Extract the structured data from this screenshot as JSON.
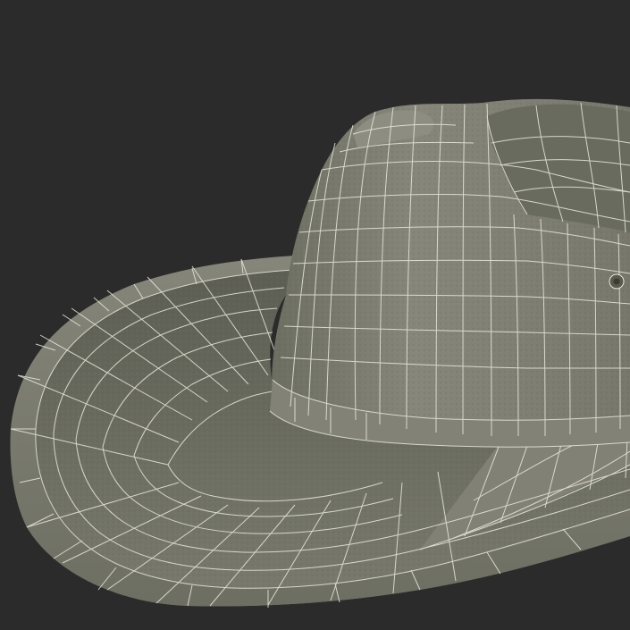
{
  "scene": {
    "subject": "cowboy-hat-wireframe",
    "background_color": "#2b2b2b",
    "surface_color": "#7b7c6f",
    "surface_shadow_color": "#5d5e53",
    "wire_color": "#e9eadc"
  }
}
